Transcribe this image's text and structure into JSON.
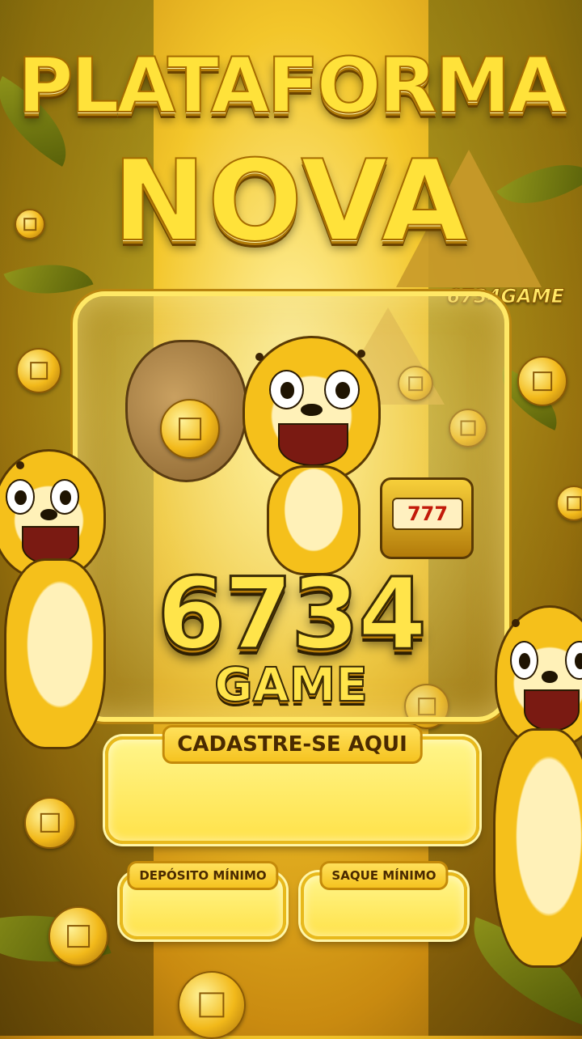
{
  "headline": {
    "line1": "PLATAFORMA",
    "line2": "NOVA"
  },
  "brand_tag": "6734GAME",
  "logo": {
    "number": "6734",
    "word": "GAME"
  },
  "signup": {
    "label": "CADASTRE-SE AQUI",
    "value": ""
  },
  "deposit": {
    "label": "DEPÓSITO MÍNIMO",
    "value": ""
  },
  "withdraw": {
    "label": "SAQUE MÍNIMO",
    "value": ""
  },
  "colors": {
    "gold": "#ffe23a",
    "dark_outline": "#3a2a05",
    "panel": "#fff58a"
  },
  "icons": [
    "coin-icon",
    "money-sack-icon",
    "slot-machine-icon",
    "cheetah-mascot"
  ]
}
